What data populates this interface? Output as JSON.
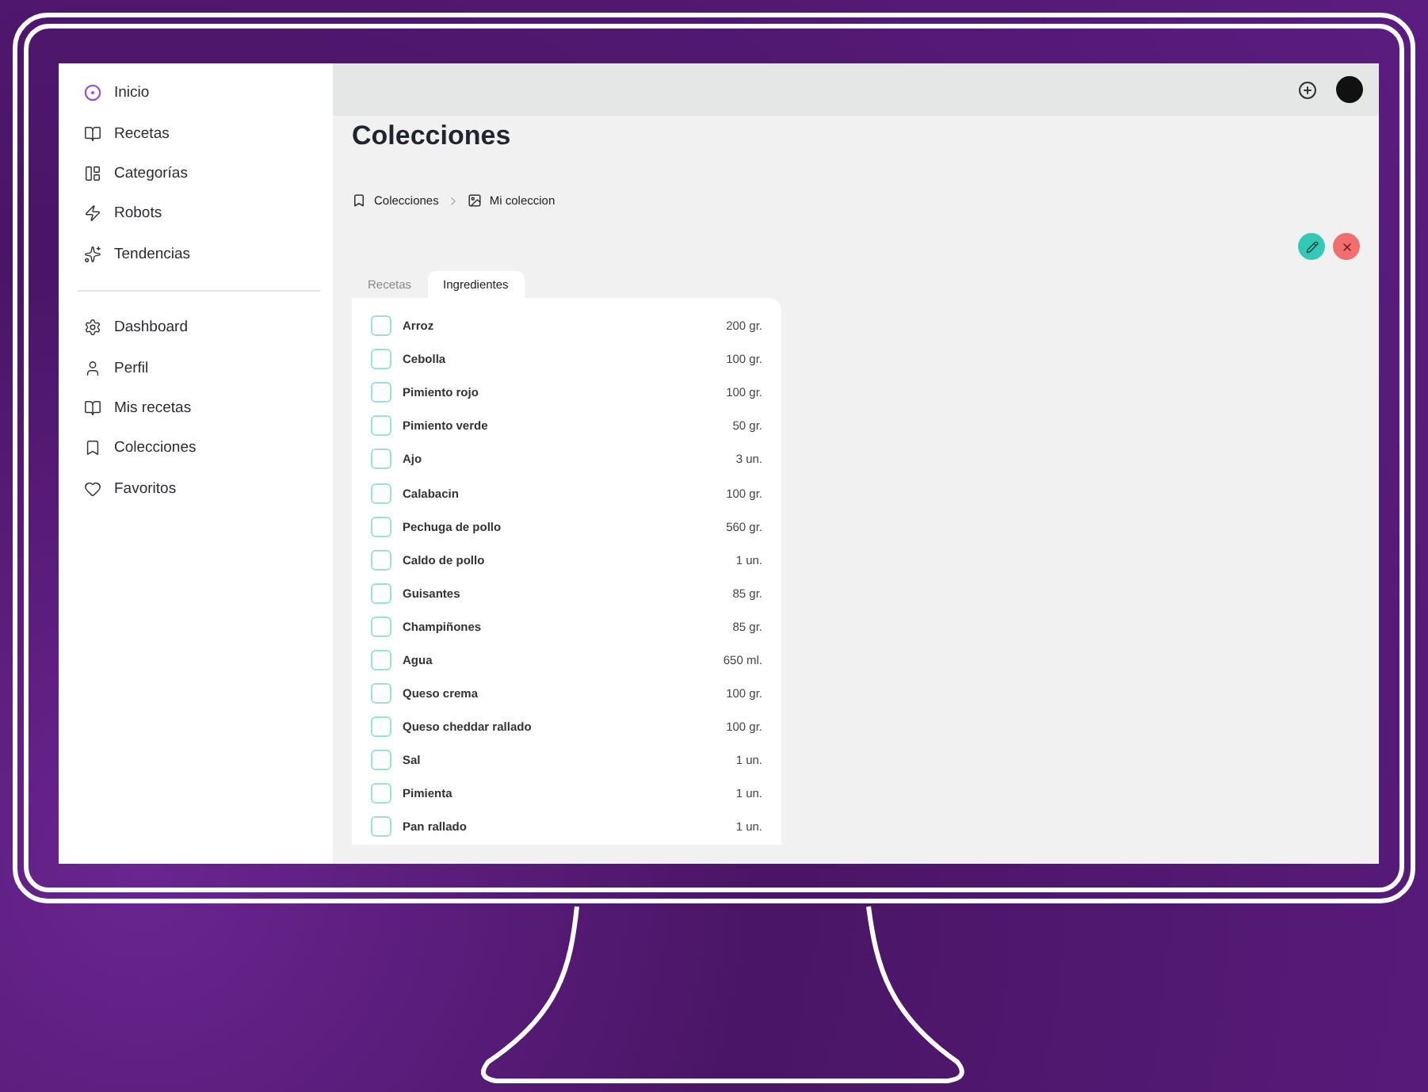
{
  "sidebar": {
    "primary": [
      {
        "label": "Inicio"
      },
      {
        "label": "Recetas"
      },
      {
        "label": "Categorías"
      },
      {
        "label": "Robots"
      },
      {
        "label": "Tendencias"
      }
    ],
    "secondary": [
      {
        "label": "Dashboard"
      },
      {
        "label": "Perfil"
      },
      {
        "label": "Mis recetas"
      },
      {
        "label": "Colecciones"
      },
      {
        "label": "Favoritos"
      }
    ]
  },
  "title": "Colecciones",
  "breadcrumb": [
    "Colecciones",
    "Mi coleccion"
  ],
  "tabs": [
    {
      "label": "Recetas",
      "selected": false
    },
    {
      "label": "Ingredientes",
      "selected": true
    }
  ],
  "ingredients": [
    {
      "name": "Arroz",
      "amount": "200 gr.",
      "checked": false
    },
    {
      "name": "Cebolla",
      "amount": "100 gr.",
      "checked": false
    },
    {
      "name": "Pimiento rojo",
      "amount": "100 gr.",
      "checked": false
    },
    {
      "name": "Pimiento verde",
      "amount": "50 gr.",
      "checked": false
    },
    {
      "name": "Ajo",
      "amount": "3 un.",
      "checked": false
    },
    {
      "name": "Calabacin",
      "amount": "100 gr.",
      "checked": false
    },
    {
      "name": "Pechuga de pollo",
      "amount": "560 gr.",
      "checked": false
    },
    {
      "name": "Caldo de pollo",
      "amount": "1 un.",
      "checked": false
    },
    {
      "name": "Guisantes",
      "amount": "85 gr.",
      "checked": false
    },
    {
      "name": "Champiñones",
      "amount": "85 gr.",
      "checked": false
    },
    {
      "name": "Agua",
      "amount": "650 ml.",
      "checked": false
    },
    {
      "name": "Queso crema",
      "amount": "100 gr.",
      "checked": false
    },
    {
      "name": "Queso cheddar rallado",
      "amount": "100 gr.",
      "checked": false
    },
    {
      "name": "Sal",
      "amount": "1 un.",
      "checked": false
    },
    {
      "name": "Pimienta",
      "amount": "1 un.",
      "checked": false
    },
    {
      "name": "Pan rallado",
      "amount": "1 un.",
      "checked": false
    }
  ]
}
